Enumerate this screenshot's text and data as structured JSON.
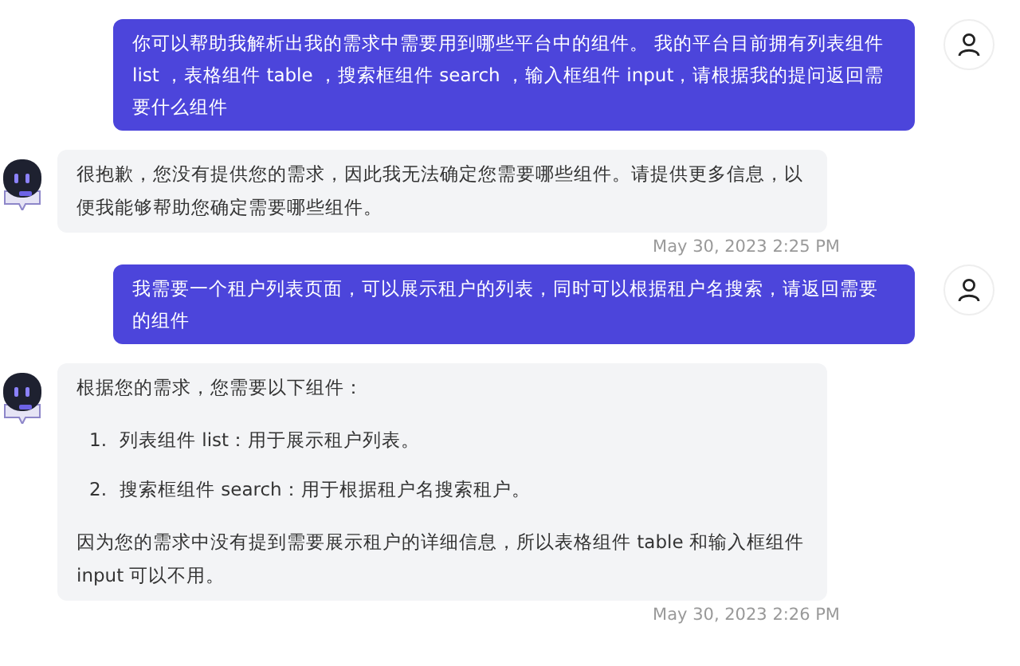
{
  "messages": [
    {
      "kind": "user",
      "blocks": [
        {
          "kind": "paragraph",
          "text": "你可以帮助我解析出我的需求中需要用到哪些平台中的组件。 我的平台目前拥有列表组件 list ，表格组件 table ，搜索框组件 search ，输入框组件 input，请根据我的提问返回需要什么组件"
        }
      ]
    },
    {
      "kind": "bot",
      "blocks": [
        {
          "kind": "paragraph",
          "text": "很抱歉，您没有提供您的需求，因此我无法确定您需要哪些组件。请提供更多信息，以便我能够帮助您确定需要哪些组件。"
        }
      ],
      "time": "May 30, 2023 2:25 PM"
    },
    {
      "kind": "user",
      "blocks": [
        {
          "kind": "paragraph",
          "text": "我需要一个租户列表页面，可以展示租户的列表，同时可以根据租户名搜索，请返回需要的组件"
        }
      ]
    },
    {
      "kind": "bot",
      "blocks": [
        {
          "kind": "paragraph",
          "text": "根据您的需求，您需要以下组件："
        },
        {
          "kind": "list",
          "items": [
            {
              "marker": "1.",
              "text": "列表组件 list：用于展示租户列表。"
            },
            {
              "marker": "2.",
              "text": "搜索框组件 search：用于根据租户名搜索租户。"
            }
          ]
        },
        {
          "kind": "paragraph",
          "text": "因为您的需求中没有提到需要展示租户的详细信息，所以表格组件 table 和输入框组件 input 可以不用。"
        }
      ],
      "time": "May 30, 2023 2:26 PM"
    }
  ]
}
